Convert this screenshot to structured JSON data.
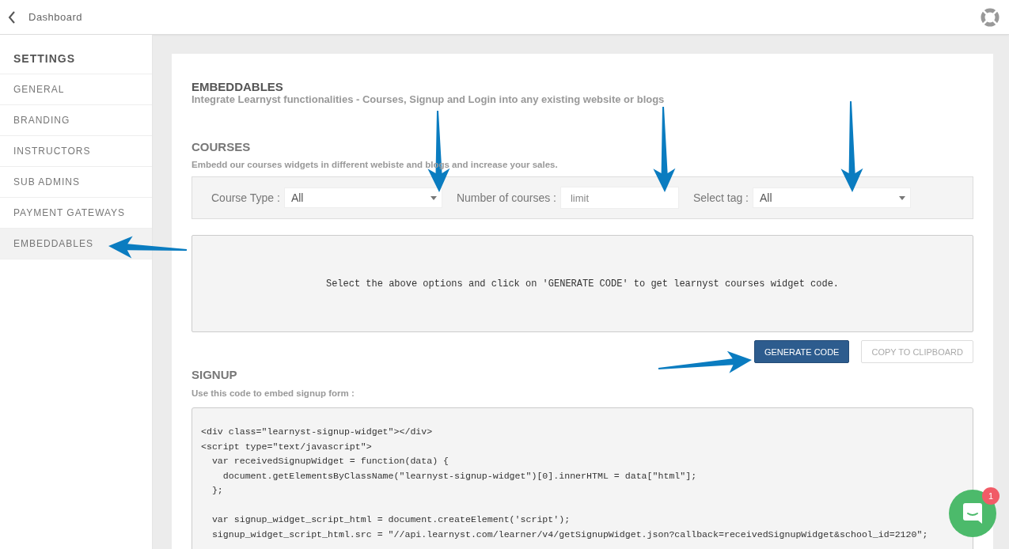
{
  "topbar": {
    "back_label": "Dashboard"
  },
  "sidebar": {
    "title": "SETTINGS",
    "items": [
      {
        "label": "GENERAL",
        "selected": false
      },
      {
        "label": "BRANDING",
        "selected": false
      },
      {
        "label": "INSTRUCTORS",
        "selected": false
      },
      {
        "label": "SUB ADMINS",
        "selected": false
      },
      {
        "label": "PAYMENT GATEWAYS",
        "selected": false
      },
      {
        "label": "EMBEDDABLES",
        "selected": true
      }
    ]
  },
  "header": {
    "title": "EMBEDDABLES",
    "subtitle": "Integrate Learnyst functionalities - Courses, Signup and Login into any existing website or blogs"
  },
  "courses": {
    "title": "COURSES",
    "subtitle": "Embedd our courses widgets in different webiste and blogs and increase your sales.",
    "filters": [
      {
        "kind": "select",
        "label": "Course Type :",
        "value": "All"
      },
      {
        "kind": "input",
        "label": "Number of courses :",
        "placeholder": "limit"
      },
      {
        "kind": "select",
        "label": "Select tag :",
        "value": "All"
      }
    ],
    "output": "Select the above options and click on 'GENERATE CODE' to get learnyst courses widget code.",
    "buttons": [
      {
        "label": "GENERATE CODE",
        "primary": true
      },
      {
        "label": "COPY TO CLIPBOARD",
        "primary": false
      }
    ]
  },
  "signup": {
    "title": "SIGNUP",
    "subtitle": "Use this code to embed signup form :",
    "code": "<div class=\"learnyst-signup-widget\"></div>\n<script type=\"text/javascript\">\n  var receivedSignupWidget = function(data) {\n    document.getElementsByClassName(\"learnyst-signup-widget\")[0].innerHTML = data[\"html\"];\n  };\n\n  var signup_widget_script_html = document.createElement('script');\n  signup_widget_script_html.src = \"//api.learnyst.com/learner/v4/getSignupWidget.json?callback=receivedSignupWidget&school_id=2120\";"
  },
  "chat": {
    "badge": "1"
  }
}
